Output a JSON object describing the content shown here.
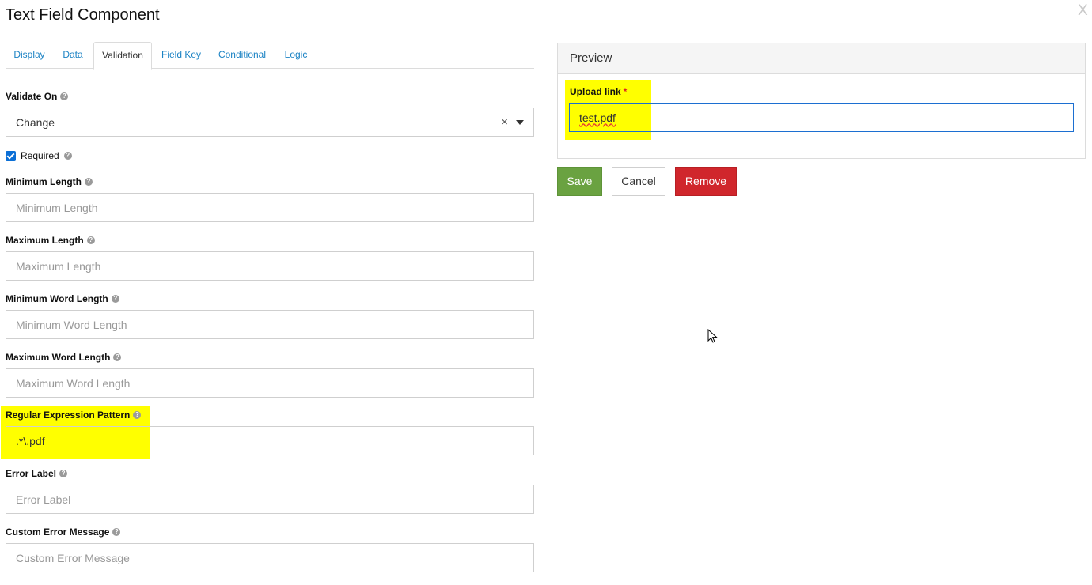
{
  "dialog": {
    "title": "Text Field Component",
    "close_label": "X"
  },
  "tabs": [
    {
      "label": "Display",
      "active": false
    },
    {
      "label": "Data",
      "active": false
    },
    {
      "label": "Validation",
      "active": true
    },
    {
      "label": "Field Key",
      "active": false
    },
    {
      "label": "Conditional",
      "active": false
    },
    {
      "label": "Logic",
      "active": false
    }
  ],
  "validation": {
    "validate_on": {
      "label": "Validate On",
      "value": "Change",
      "clear_symbol": "×"
    },
    "required": {
      "label": "Required",
      "checked": true
    },
    "min_length": {
      "label": "Minimum Length",
      "placeholder": "Minimum Length",
      "value": ""
    },
    "max_length": {
      "label": "Maximum Length",
      "placeholder": "Maximum Length",
      "value": ""
    },
    "min_word_length": {
      "label": "Minimum Word Length",
      "placeholder": "Minimum Word Length",
      "value": ""
    },
    "max_word_length": {
      "label": "Maximum Word Length",
      "placeholder": "Maximum Word Length",
      "value": ""
    },
    "regex": {
      "label": "Regular Expression Pattern",
      "placeholder": "",
      "value": ".*\\.pdf"
    },
    "error_label": {
      "label": "Error Label",
      "placeholder": "Error Label",
      "value": ""
    },
    "custom_error": {
      "label": "Custom Error Message",
      "placeholder": "Custom Error Message",
      "value": ""
    }
  },
  "preview": {
    "title": "Preview",
    "field_label": "Upload link",
    "required_marker": "*",
    "field_value": "test.pdf"
  },
  "actions": {
    "save": "Save",
    "cancel": "Cancel",
    "remove": "Remove"
  },
  "colors": {
    "highlight": "#ffff00",
    "save": "#6aa241",
    "remove": "#d0262c",
    "link": "#1a82c4",
    "focus": "#1c6fd1"
  },
  "icons": {
    "help": "question-circle-icon",
    "checkbox": "checkmark-icon",
    "caret": "caret-down-icon",
    "cursor": "mouse-pointer-icon"
  }
}
